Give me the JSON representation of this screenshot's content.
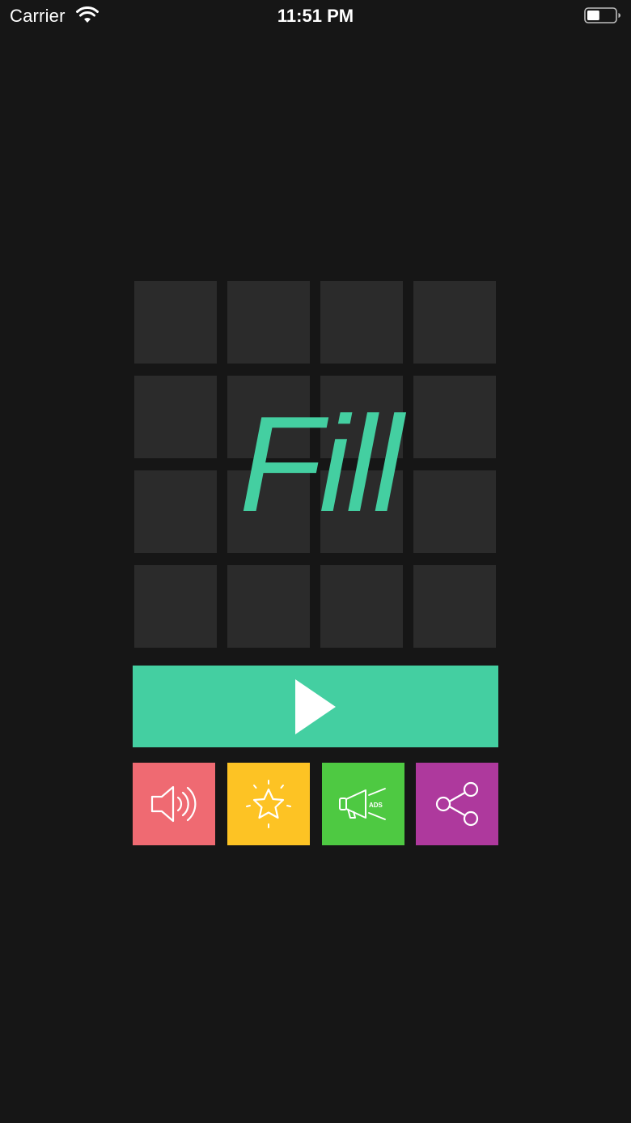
{
  "status_bar": {
    "carrier": "Carrier",
    "time": "11:51 PM",
    "wifi_icon": "wifi-icon",
    "battery_icon": "battery-icon",
    "battery_level": 0.45
  },
  "logo": {
    "text": "Fill",
    "color": "#44cfa1"
  },
  "grid": {
    "rows": 4,
    "columns": 4,
    "tile_color": "#2b2b2b"
  },
  "play_button": {
    "icon": "play-icon",
    "color": "#44cfa1"
  },
  "action_buttons": [
    {
      "name": "sound",
      "icon": "speaker-icon",
      "color": "#ef6a72"
    },
    {
      "name": "rate",
      "icon": "star-icon",
      "color": "#fdc324"
    },
    {
      "name": "ads",
      "icon": "megaphone-icon",
      "label": "ADS",
      "color": "#4ec942"
    },
    {
      "name": "share",
      "icon": "share-icon",
      "color": "#ae399d"
    }
  ],
  "colors": {
    "background": "#161616",
    "accent": "#44cfa1"
  }
}
